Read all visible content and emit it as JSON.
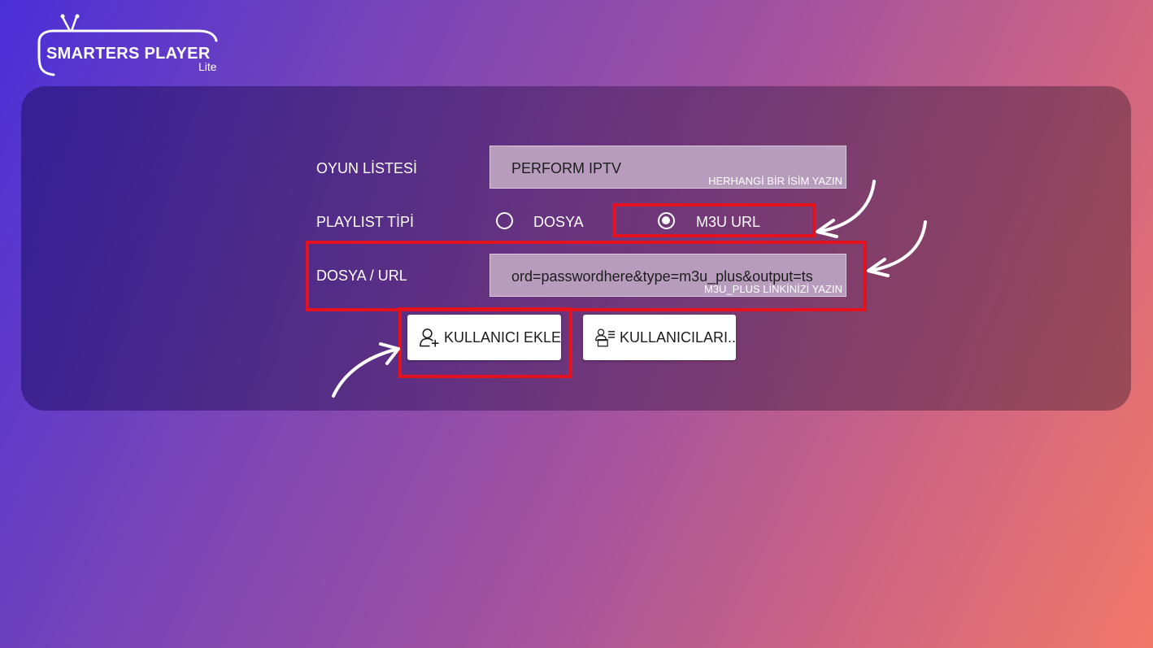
{
  "app": {
    "logo_title": "SMARTERS PLAYER",
    "logo_subtitle": "Lite"
  },
  "form": {
    "playlist_name": {
      "label": "OYUN LİSTESİ",
      "value": "PERFORM IPTV",
      "hint": "HERHANGİ BİR İSİM YAZIN"
    },
    "playlist_type": {
      "label": "PLAYLIST TİPİ",
      "options": [
        {
          "label": "DOSYA",
          "selected": false
        },
        {
          "label": "M3U URL",
          "selected": true
        }
      ]
    },
    "file_url": {
      "label": "DOSYA / URL",
      "value": "ord=passwordhere&type=m3u_plus&output=ts",
      "hint": "M3U_PLUS LİNKİNİZİ YAZIN"
    }
  },
  "buttons": {
    "add_user": "KULLANICI EKLE",
    "users": "KULLANICILARI.."
  },
  "colors": {
    "highlight": "#e4121f",
    "field_bg": "#b79cbd",
    "button_bg": "#ffffff"
  },
  "icons": [
    "tv-icon",
    "add-user-icon",
    "users-list-icon"
  ]
}
